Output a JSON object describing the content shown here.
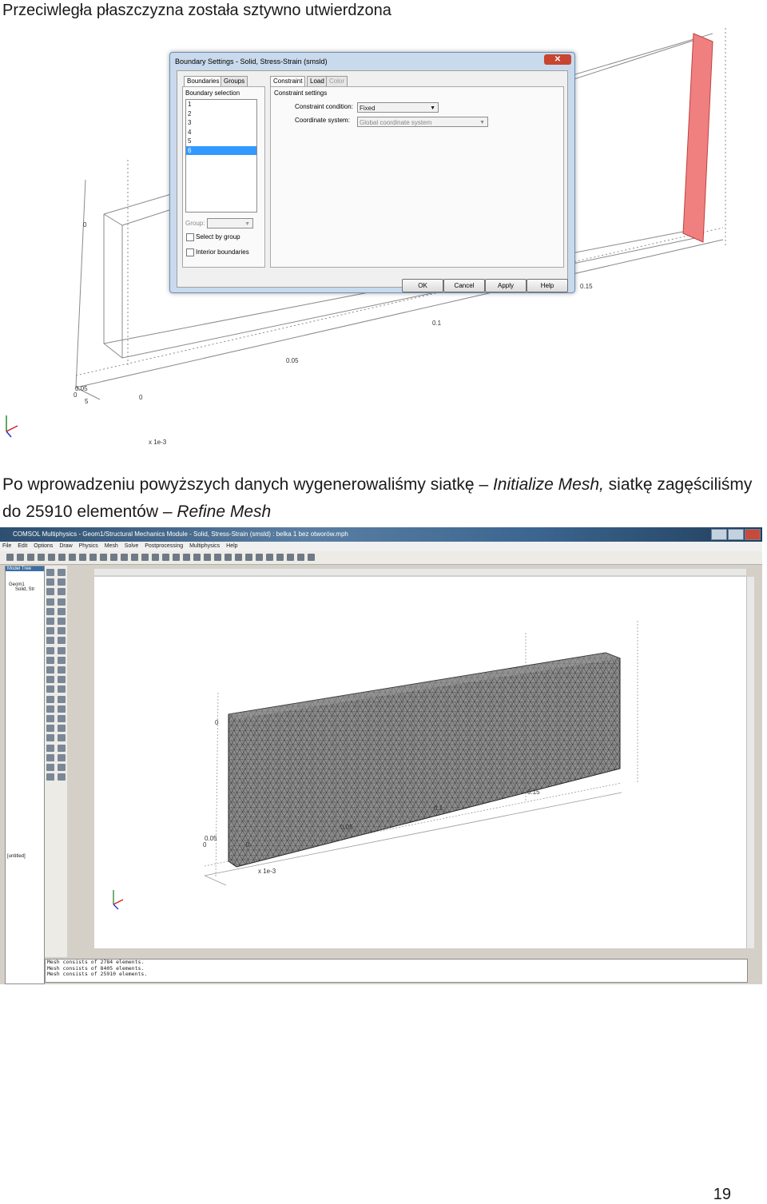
{
  "heading": "Przeciwległa płaszczyzna została sztywno utwierdzona",
  "paragraph": {
    "part1": "Po wprowadzeniu powyższych danych wygenerowaliśmy siatkę – ",
    "em1": "Initialize Mesh,",
    "part2": " siatkę zagęściliśmy do 25910 elementów – ",
    "em2": "Refine Mesh"
  },
  "page_number": "19",
  "figure1": {
    "dialog": {
      "title": "Boundary Settings - Solid, Stress-Strain (smsld)",
      "close": "✕",
      "left_tabs": [
        "Boundaries",
        "Groups"
      ],
      "right_tabs": [
        "Constraint",
        "Load",
        "Color"
      ],
      "boundary_selection_label": "Boundary selection",
      "boundaries": [
        "1",
        "2",
        "3",
        "4",
        "5",
        "6"
      ],
      "selected_boundary": "6",
      "group_label": "Group:",
      "select_by_group": "Select by group",
      "interior_boundaries": "Interior boundaries",
      "constraint_settings_label": "Constraint settings",
      "constraint_condition_label": "Constraint condition:",
      "constraint_condition_value": "Fixed",
      "coordinate_system_label": "Coordinate system:",
      "coordinate_system_value": "Global coordinate system",
      "buttons": [
        "OK",
        "Cancel",
        "Apply",
        "Help"
      ]
    },
    "axis_labels": {
      "t015": "0.15",
      "t01": "0.1",
      "t005": "0.05",
      "t0": "0",
      "tneg005": "0.05",
      "t0b": "0",
      "t5": "5",
      "zero_side": "0",
      "scale": "x 1e-3"
    },
    "face_color": "#f08080"
  },
  "figure2": {
    "title": "COMSOL Multiphysics - Geom1/Structural Mechanics Module - Solid, Stress-Strain (smsld) : belka 1 bez otworów.mph",
    "menu": [
      "File",
      "Edit",
      "Options",
      "Draw",
      "Physics",
      "Mesh",
      "Solve",
      "Postprocessing",
      "Multiphysics",
      "Help"
    ],
    "model_tree": {
      "header": "Model Tree",
      "root": "Geom1",
      "child": "Solid, Str",
      "untitled": "[untitled]"
    },
    "axis_labels": {
      "t015": "0.15",
      "t01": "0.1",
      "t005": "0.05",
      "tneg005": "0.05",
      "t0": "0",
      "t0b": "0",
      "zero_side": "0",
      "scale": "x 1e-3"
    },
    "log": [
      "Mesh consists of 2784 elements.",
      "Mesh consists of 8405 elements.",
      "Mesh consists of 25910 elements."
    ],
    "mesh_color": "#8e8e8e"
  }
}
